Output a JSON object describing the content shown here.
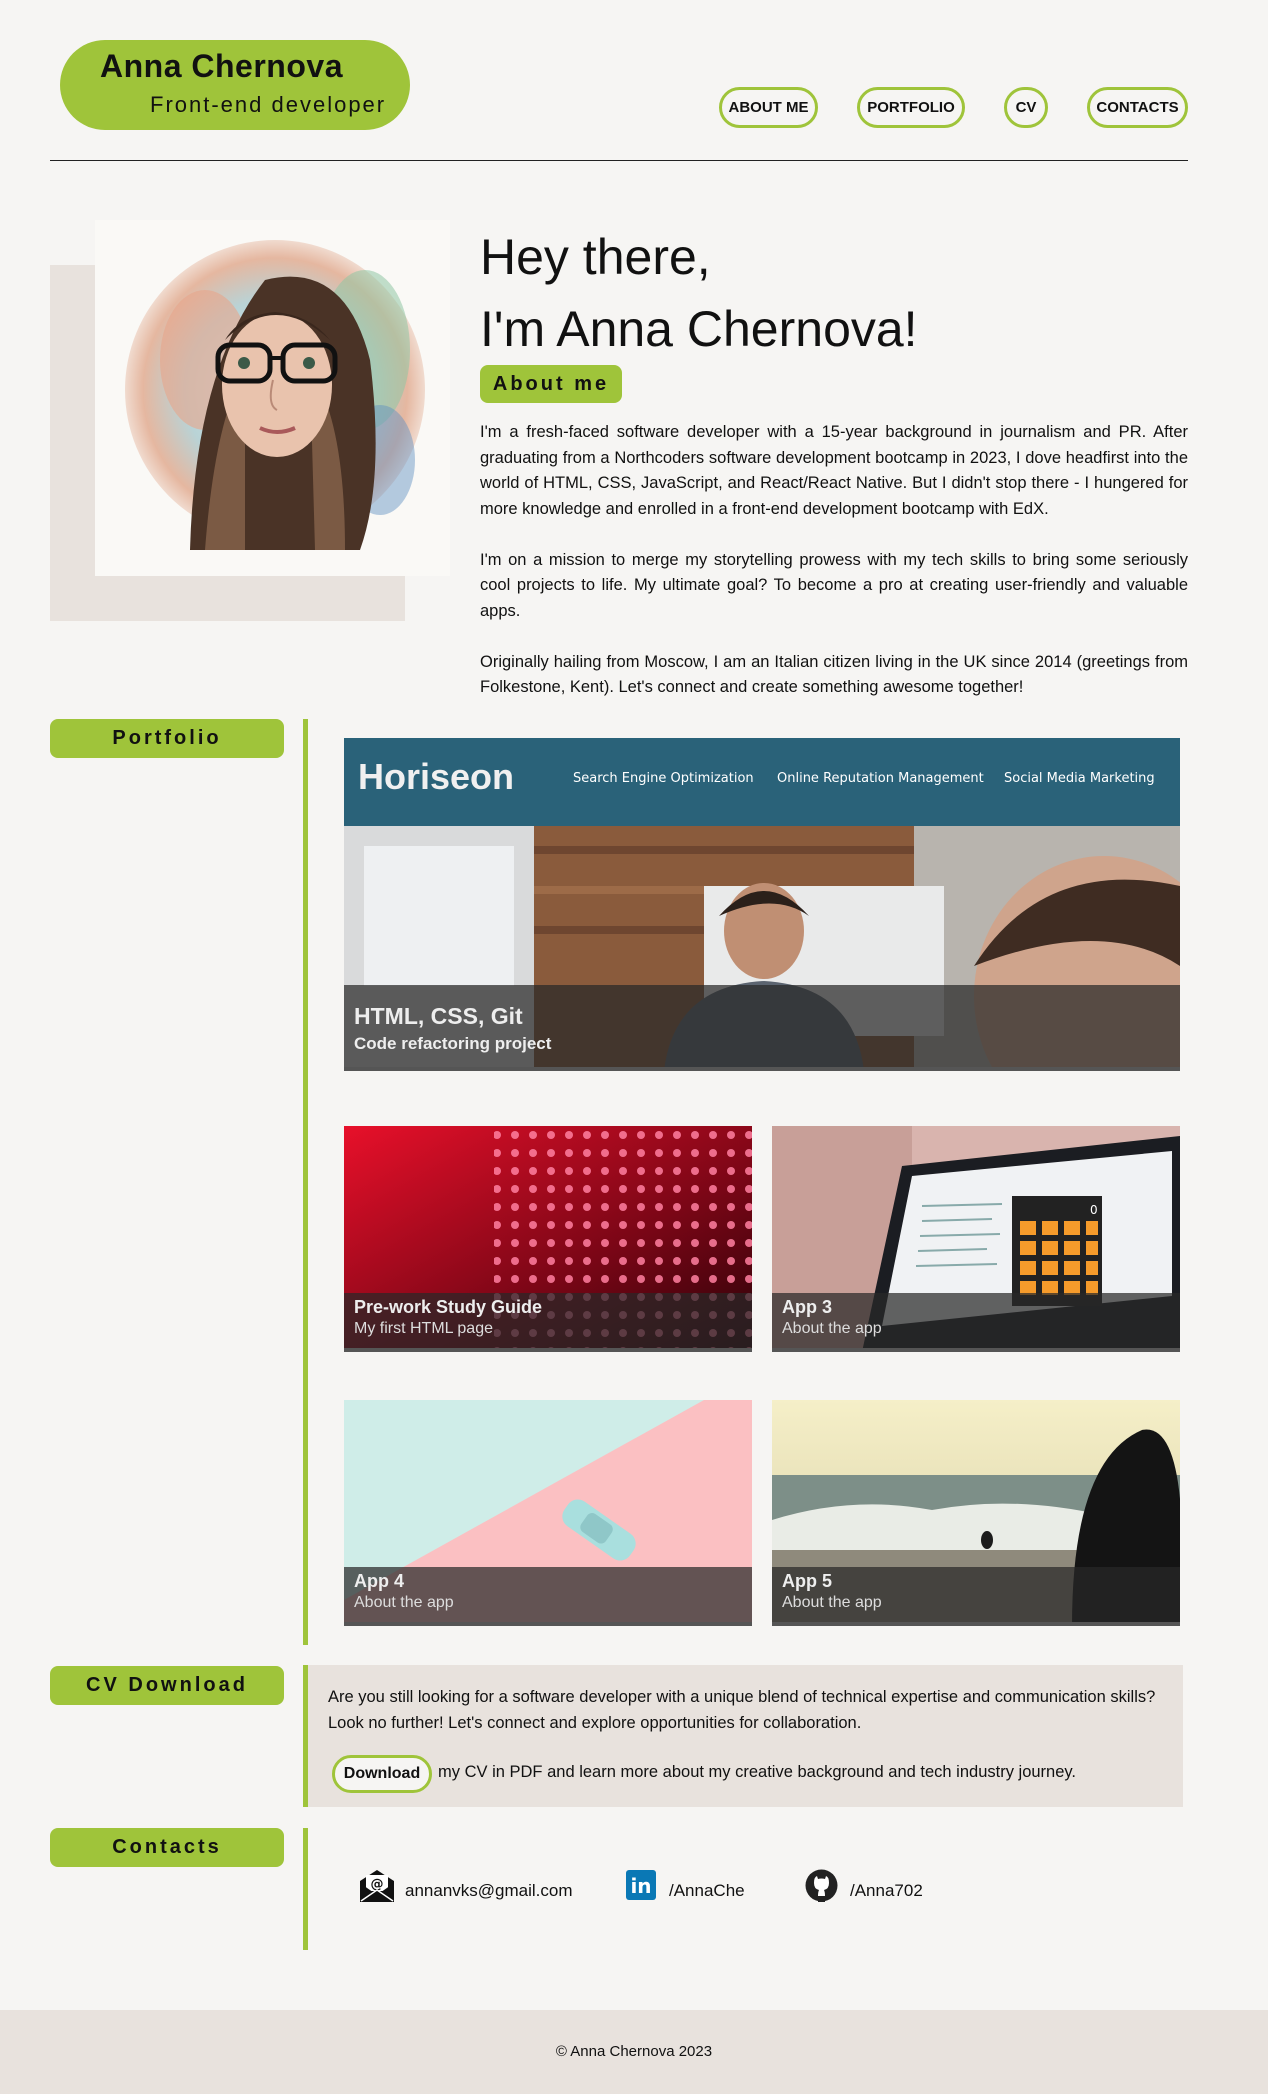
{
  "header": {
    "name": "Anna Chernova",
    "subtitle": "Front-end developer",
    "nav": [
      "ABOUT ME",
      "PORTFOLIO",
      "CV",
      "CONTACTS"
    ]
  },
  "hero": {
    "line1": "Hey there,",
    "line2": "I'm Anna Chernova!",
    "about_label": "About me",
    "paragraphs": [
      "I'm a fresh-faced software developer with a 15-year background in journalism and PR. After graduating from a Northcoders software development bootcamp in 2023, I dove headfirst into the world of HTML, CSS, JavaScript, and React/React Native. But I didn't stop there - I hungered for more knowledge and enrolled in a front-end development bootcamp with EdX.",
      "I'm on a mission to merge my storytelling prowess with my tech skills to bring some seriously cool projects to life. My ultimate goal? To become a pro at creating user-friendly and valuable apps.",
      "Originally hailing from Moscow, I am an Italian citizen living in the UK since 2014 (greetings from Folkestone, Kent). Let's connect and create something awesome together!"
    ]
  },
  "portfolio": {
    "label": "Portfolio",
    "featured": {
      "logo": "Horiseon",
      "nav": [
        "Search Engine Optimization",
        "Online Reputation Management",
        "Social Media Marketing"
      ],
      "title": "HTML, CSS, Git",
      "subtitle": "Code refactoring project"
    },
    "cards": [
      {
        "title": "Pre-work Study Guide",
        "subtitle": "My first HTML page",
        "calc_display": "0"
      },
      {
        "title": "App 3",
        "subtitle": "About the app"
      },
      {
        "title": "App 4",
        "subtitle": "About the app"
      },
      {
        "title": "App 5",
        "subtitle": "About the app"
      }
    ]
  },
  "cv": {
    "label": "CV Download",
    "text": "Are you still looking for a software developer with a unique blend of technical expertise and communication skills? Look no further! Let's connect and explore opportunities for collaboration.",
    "button": "Download",
    "after_button": "my CV in PDF and learn more about my creative background and tech industry journey."
  },
  "contacts": {
    "label": "Contacts",
    "email": "annanvks@gmail.com",
    "linkedin": "/AnnaChe",
    "github": "/Anna702",
    "email_icon_glyph": "@",
    "linkedin_icon_glyph": "in"
  },
  "footer": {
    "text": "© Anna Chernova 2023"
  },
  "colors": {
    "accent": "#9fc43a",
    "background": "#f6f5f3",
    "panel": "#e8e2dd",
    "horiseon_header": "#2a6279"
  }
}
